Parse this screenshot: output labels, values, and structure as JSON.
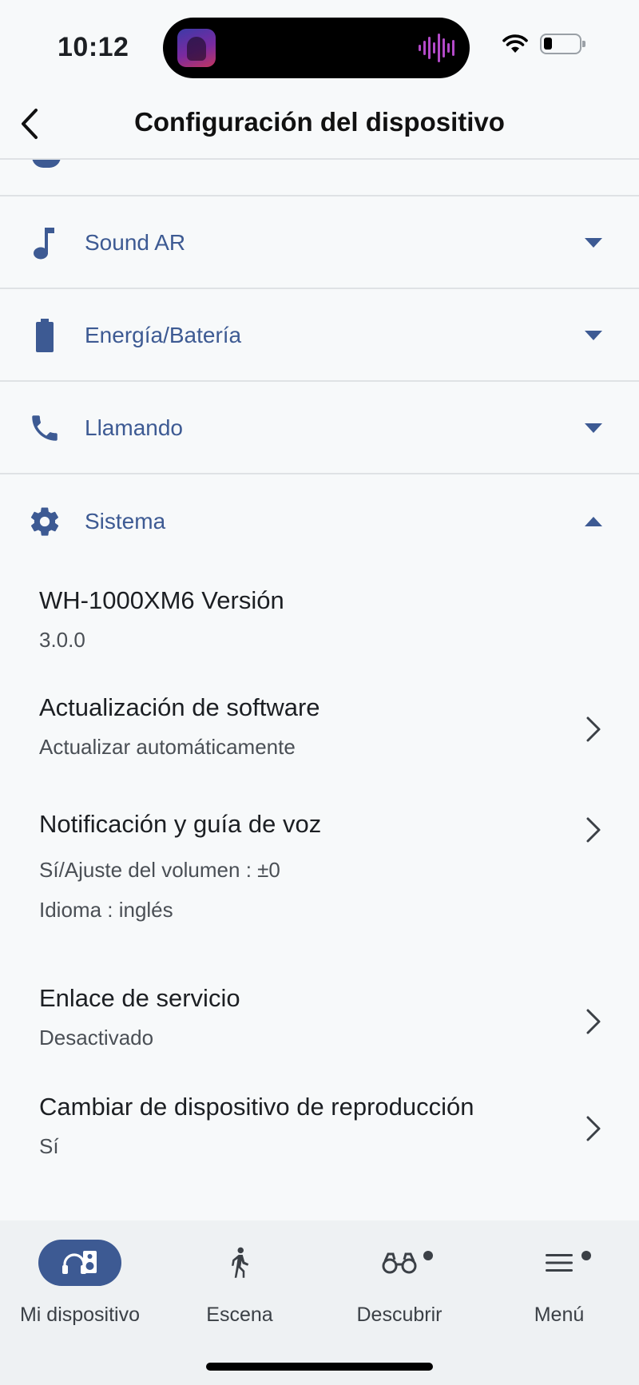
{
  "status_bar": {
    "time": "10:12"
  },
  "nav": {
    "title": "Configuración del dispositivo"
  },
  "sections": [
    {
      "label": "Sound AR",
      "icon": "music-note-icon",
      "state": "collapsed"
    },
    {
      "label": "Energía/Batería",
      "icon": "battery-icon",
      "state": "collapsed"
    },
    {
      "label": "Llamando",
      "icon": "phone-icon",
      "state": "collapsed"
    },
    {
      "label": "Sistema",
      "icon": "gear-icon",
      "state": "expanded"
    }
  ],
  "sistema": {
    "version": {
      "title": "WH-1000XM6 Versión",
      "value": "3.0.0"
    },
    "software_update": {
      "title": "Actualización de software",
      "value": "Actualizar automáticamente"
    },
    "voice_guide": {
      "title": "Notificación y guía de voz",
      "volume": "Sí/Ajuste del volumen : ±0",
      "language": "Idioma : inglés"
    },
    "service_link": {
      "title": "Enlace de servicio",
      "value": "Desactivado"
    },
    "playback_switch": {
      "title": "Cambiar de dispositivo de reproducción",
      "value": "Sí"
    }
  },
  "tab_bar": {
    "tabs": [
      {
        "label": "Mi dispositivo",
        "icon": "headphones-speaker-icon",
        "active": true
      },
      {
        "label": "Escena",
        "icon": "walking-person-icon",
        "active": false
      },
      {
        "label": "Descubrir",
        "icon": "binoculars-icon",
        "active": false,
        "badge": true
      },
      {
        "label": "Menú",
        "icon": "hamburger-menu-icon",
        "active": false,
        "badge": true
      }
    ]
  },
  "colors": {
    "accent": "#3d5a93",
    "background": "#f7f9fa",
    "tab_bar": "#eef1f3",
    "divider": "#dfe2e5"
  }
}
